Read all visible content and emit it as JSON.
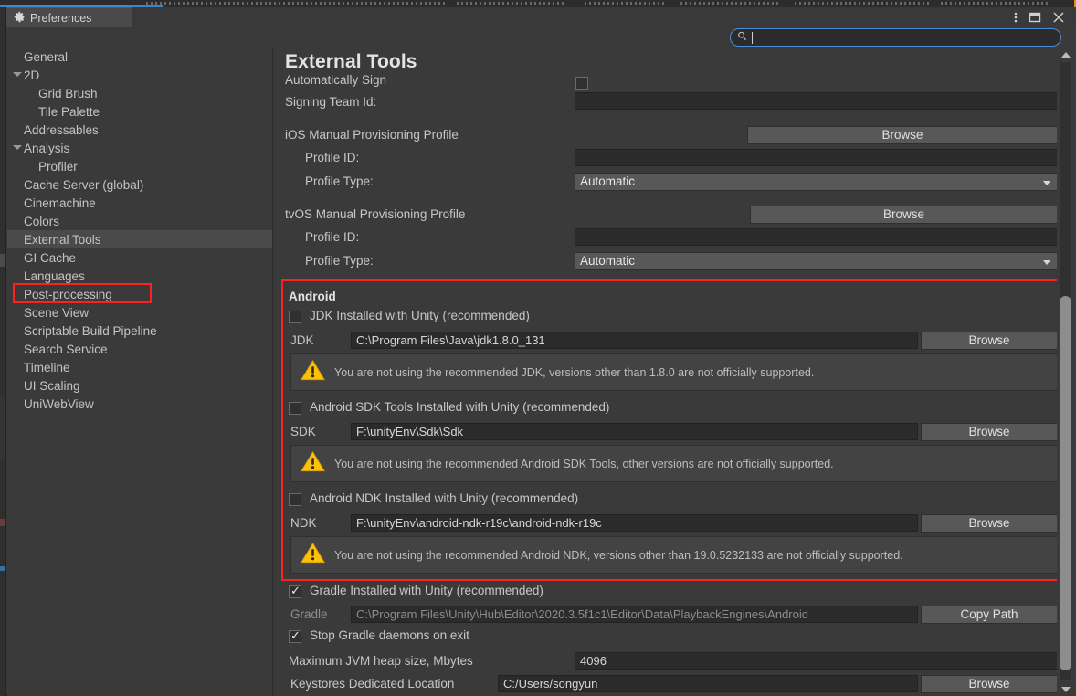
{
  "window": {
    "tab_label": "Preferences",
    "tab_icon": "gear-icon",
    "more_icon": "kebab-menu-icon",
    "maximize_icon": "maximize-icon",
    "close_icon": "close-icon",
    "accent_border": "#e08a2a"
  },
  "search": {
    "icon": "search-icon",
    "value": "",
    "placeholder": ""
  },
  "sidebar": {
    "items": [
      {
        "label": "General",
        "indent": 0,
        "arrow": false,
        "selected": false
      },
      {
        "label": "2D",
        "indent": 0,
        "arrow": true,
        "selected": false
      },
      {
        "label": "Grid Brush",
        "indent": 1,
        "arrow": false,
        "selected": false
      },
      {
        "label": "Tile Palette",
        "indent": 1,
        "arrow": false,
        "selected": false
      },
      {
        "label": "Addressables",
        "indent": 0,
        "arrow": false,
        "selected": false
      },
      {
        "label": "Analysis",
        "indent": 0,
        "arrow": true,
        "selected": false
      },
      {
        "label": "Profiler",
        "indent": 1,
        "arrow": false,
        "selected": false
      },
      {
        "label": "Cache Server (global)",
        "indent": 0,
        "arrow": false,
        "selected": false
      },
      {
        "label": "Cinemachine",
        "indent": 0,
        "arrow": false,
        "selected": false
      },
      {
        "label": "Colors",
        "indent": 0,
        "arrow": false,
        "selected": false
      },
      {
        "label": "External Tools",
        "indent": 0,
        "arrow": false,
        "selected": true
      },
      {
        "label": "GI Cache",
        "indent": 0,
        "arrow": false,
        "selected": false
      },
      {
        "label": "Languages",
        "indent": 0,
        "arrow": false,
        "selected": false
      },
      {
        "label": "Post-processing",
        "indent": 0,
        "arrow": false,
        "selected": false
      },
      {
        "label": "Scene View",
        "indent": 0,
        "arrow": false,
        "selected": false
      },
      {
        "label": "Scriptable Build Pipeline",
        "indent": 0,
        "arrow": false,
        "selected": false
      },
      {
        "label": "Search Service",
        "indent": 0,
        "arrow": false,
        "selected": false
      },
      {
        "label": "Timeline",
        "indent": 0,
        "arrow": false,
        "selected": false
      },
      {
        "label": "UI Scaling",
        "indent": 0,
        "arrow": false,
        "selected": false
      },
      {
        "label": "UniWebView",
        "indent": 0,
        "arrow": false,
        "selected": false
      }
    ],
    "highlight_color": "#ff2020"
  },
  "main": {
    "title": "External Tools",
    "auto_sign": {
      "label": "Automatically Sign",
      "checked": false
    },
    "signing_team_id": {
      "label": "Signing Team Id:",
      "value": ""
    },
    "ios_profile": {
      "label": "iOS Manual Provisioning Profile",
      "browse_label": "Browse",
      "profile_id_label": "Profile ID:",
      "profile_id_value": "",
      "profile_type_label": "Profile Type:",
      "profile_type_value": "Automatic"
    },
    "tvos_profile": {
      "label": "tvOS Manual Provisioning Profile",
      "browse_label": "Browse",
      "profile_id_label": "Profile ID:",
      "profile_id_value": "",
      "profile_type_label": "Profile Type:",
      "profile_type_value": "Automatic"
    },
    "android": {
      "header": "Android",
      "highlight_color": "#ff2020",
      "jdk": {
        "checkbox_label": "JDK Installed with Unity (recommended)",
        "checked": false,
        "field_label": "JDK",
        "path": "C:\\Program Files\\Java\\jdk1.8.0_131",
        "browse_label": "Browse",
        "warning_icon": "warning-triangle-icon",
        "warning": "You are not using the recommended JDK, versions other than 1.8.0 are not officially supported."
      },
      "sdk": {
        "checkbox_label": "Android SDK Tools Installed with Unity (recommended)",
        "checked": false,
        "field_label": "SDK",
        "path": "F:\\unityEnv\\Sdk\\Sdk",
        "browse_label": "Browse",
        "warning_icon": "warning-triangle-icon",
        "warning": "You are not using the recommended Android SDK Tools, other versions are not officially supported."
      },
      "ndk": {
        "checkbox_label": "Android NDK Installed with Unity (recommended)",
        "checked": false,
        "field_label": "NDK",
        "path": "F:\\unityEnv\\android-ndk-r19c\\android-ndk-r19c",
        "browse_label": "Browse",
        "warning_icon": "warning-triangle-icon",
        "warning": "You are not using the recommended Android NDK, versions other than 19.0.5232133 are not officially supported."
      }
    },
    "gradle": {
      "checkbox_label": "Gradle Installed with Unity (recommended)",
      "checked": true,
      "field_label": "Gradle",
      "path": "C:\\Program Files\\Unity\\Hub\\Editor\\2020.3.5f1c1\\Editor\\Data\\PlaybackEngines\\Android",
      "copy_path_label": "Copy Path",
      "stop_daemons_label": "Stop Gradle daemons on exit",
      "stop_daemons_checked": true,
      "jvm_heap_label": "Maximum JVM heap size, Mbytes",
      "jvm_heap_value": "4096",
      "keystores_label": "Keystores Dedicated Location",
      "keystores_value": "C:/Users/songyun",
      "keystores_browse_label": "Browse"
    }
  },
  "scrollbar": {
    "up_icon": "scroll-up-arrow-icon",
    "down_icon": "scroll-down-arrow-icon",
    "thumb_top_pct": 38,
    "thumb_height_pct": 57
  }
}
